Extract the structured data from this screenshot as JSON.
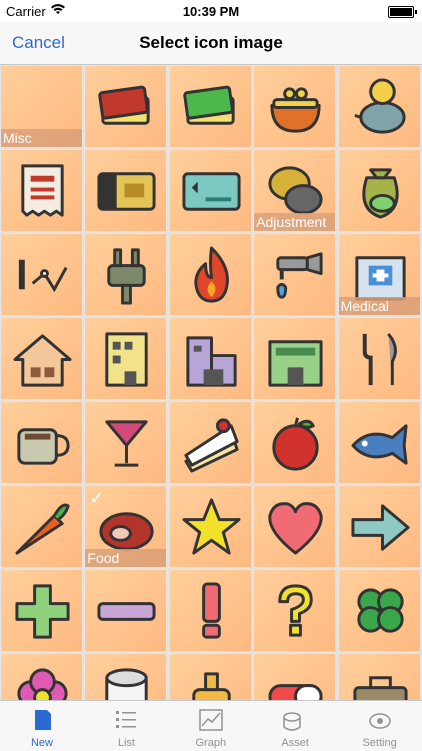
{
  "status": {
    "carrier": "Carrier",
    "time": "10:39 PM"
  },
  "nav": {
    "cancel": "Cancel",
    "title": "Select icon image"
  },
  "icons": [
    {
      "name": "misc",
      "caption": "Misc"
    },
    {
      "name": "card-red"
    },
    {
      "name": "card-green"
    },
    {
      "name": "coin-purse"
    },
    {
      "name": "piggy-bank"
    },
    {
      "name": "receipt"
    },
    {
      "name": "credit-card-gold"
    },
    {
      "name": "credit-card-teal"
    },
    {
      "name": "coins",
      "caption": "Adjustment"
    },
    {
      "name": "money-bag"
    },
    {
      "name": "stock-chart"
    },
    {
      "name": "plug"
    },
    {
      "name": "fire"
    },
    {
      "name": "faucet"
    },
    {
      "name": "hospital",
      "caption": "Medical"
    },
    {
      "name": "house"
    },
    {
      "name": "building-yellow"
    },
    {
      "name": "building-purple"
    },
    {
      "name": "store-green"
    },
    {
      "name": "fork-knife"
    },
    {
      "name": "coffee-cup"
    },
    {
      "name": "cocktail"
    },
    {
      "name": "cake"
    },
    {
      "name": "apple"
    },
    {
      "name": "fish"
    },
    {
      "name": "carrot"
    },
    {
      "name": "meat",
      "caption": "Food",
      "selected": true
    },
    {
      "name": "star"
    },
    {
      "name": "heart"
    },
    {
      "name": "arrow-right"
    },
    {
      "name": "plus"
    },
    {
      "name": "minus"
    },
    {
      "name": "exclamation"
    },
    {
      "name": "question"
    },
    {
      "name": "clover"
    },
    {
      "name": "flower"
    },
    {
      "name": "toilet-paper"
    },
    {
      "name": "bottle"
    },
    {
      "name": "pill"
    },
    {
      "name": "bag"
    }
  ],
  "tabs": [
    {
      "label": "New",
      "icon": "new-icon",
      "active": true
    },
    {
      "label": "List",
      "icon": "list-icon"
    },
    {
      "label": "Graph",
      "icon": "graph-icon"
    },
    {
      "label": "Asset",
      "icon": "asset-icon"
    },
    {
      "label": "Setting",
      "icon": "setting-icon"
    }
  ]
}
